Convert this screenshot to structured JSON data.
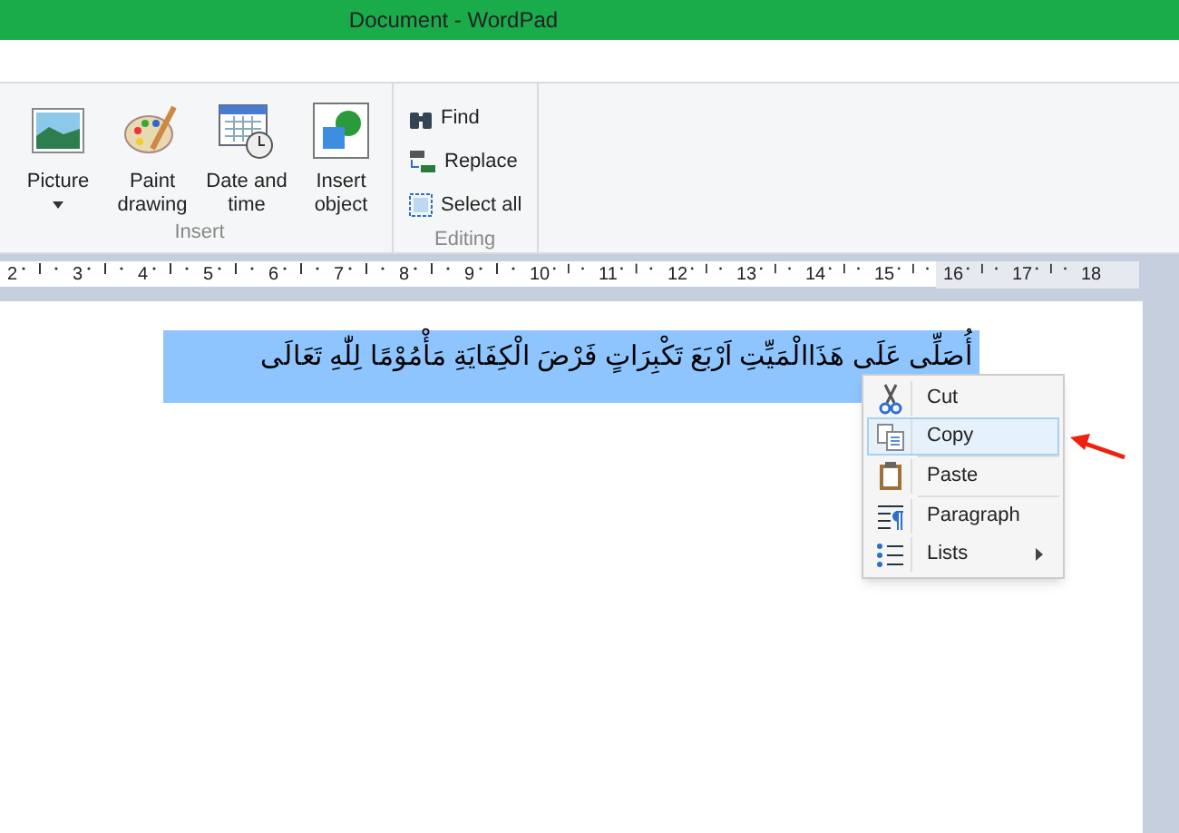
{
  "window": {
    "title": "Document - WordPad"
  },
  "ribbon": {
    "groups": [
      {
        "label": "Insert",
        "kind": "large",
        "items": [
          {
            "label": "Picture",
            "dropdown": true
          },
          {
            "label": "Paint drawing",
            "dropdown": false
          },
          {
            "label": "Date and time",
            "dropdown": false
          },
          {
            "label": "Insert object",
            "dropdown": false
          }
        ]
      },
      {
        "label": "Editing",
        "kind": "small",
        "items": [
          {
            "label": "Find"
          },
          {
            "label": "Replace"
          },
          {
            "label": "Select all"
          }
        ]
      }
    ]
  },
  "ruler": [
    "2",
    "3",
    "4",
    "5",
    "6",
    "7",
    "8",
    "9",
    "10",
    "11",
    "12",
    "13",
    "14",
    "15",
    "16",
    "17",
    "18"
  ],
  "document": {
    "text": "أُصَلِّى عَلَى هَذَاالْمَيِّتِ اَرْبَعَ تَكْبِرَاتٍ فَرْضَ الْكِفَايَةِ مَأْمُوْمًا لِلّٰهِ تَعَالَى",
    "selected": true
  },
  "context_menu": {
    "items": [
      {
        "label": "Cut",
        "selected": false,
        "submenu": false
      },
      {
        "label": "Copy",
        "selected": true,
        "submenu": false
      },
      {
        "label": "Paste",
        "selected": false,
        "submenu": false
      },
      {
        "label": "Paragraph",
        "selected": false,
        "submenu": false
      },
      {
        "label": "Lists",
        "selected": false,
        "submenu": true
      }
    ]
  }
}
